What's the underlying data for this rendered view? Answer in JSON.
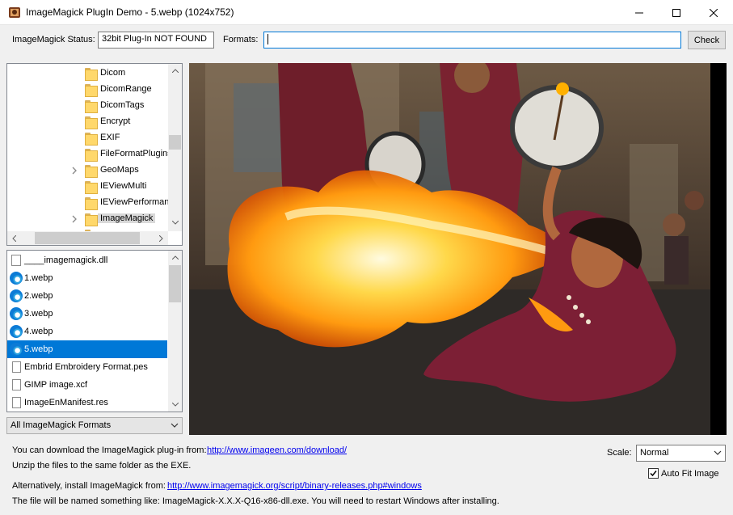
{
  "window": {
    "title": "ImageMagick PlugIn Demo - 5.webp (1024x752)",
    "controls": [
      "minimize-icon",
      "maximize-icon",
      "close-icon"
    ]
  },
  "status_bar": {
    "status_label": "ImageMagick Status:",
    "status_value": "32bit Plug-In NOT FOUND",
    "formats_label": "Formats:",
    "formats_value": "",
    "check_label": "Check"
  },
  "folder_tree": {
    "items": [
      {
        "label": "Dicom",
        "expandable": false
      },
      {
        "label": "DicomRange",
        "expandable": false
      },
      {
        "label": "DicomTags",
        "expandable": false
      },
      {
        "label": "Encrypt",
        "expandable": false
      },
      {
        "label": "EXIF",
        "expandable": false
      },
      {
        "label": "FileFormatPlugins",
        "expandable": false
      },
      {
        "label": "GeoMaps",
        "expandable": true
      },
      {
        "label": "IEViewMulti",
        "expandable": false
      },
      {
        "label": "IEViewPerformance",
        "expandable": false
      },
      {
        "label": "ImageMagick",
        "expandable": true,
        "selected": true
      }
    ]
  },
  "file_list": {
    "items": [
      {
        "label": "____imagemagick.dll",
        "icon": "dll-file-icon"
      },
      {
        "label": "1.webp",
        "icon": "edge-icon"
      },
      {
        "label": "2.webp",
        "icon": "edge-icon"
      },
      {
        "label": "3.webp",
        "icon": "edge-icon"
      },
      {
        "label": "4.webp",
        "icon": "edge-icon"
      },
      {
        "label": "5.webp",
        "icon": "edge-icon",
        "selected": true
      },
      {
        "label": "Embrid Embroidery Format.pes",
        "icon": "document-icon"
      },
      {
        "label": "GIMP image.xcf",
        "icon": "document-icon"
      },
      {
        "label": "ImageEnManifest.res",
        "icon": "document-icon"
      }
    ]
  },
  "filter": {
    "value": "All ImageMagick Formats"
  },
  "viewer": {
    "subject": "fire-breather performer with drummers",
    "accent": "#ffb000"
  },
  "info": {
    "download_text": "You can download the ImageMagick plug-in from:",
    "download_link": "http://www.imageen.com/download/",
    "unzip_text": "Unzip the files to the same folder as the EXE.",
    "alt_text": "Alternatively, install ImageMagick from:",
    "alt_link": "http://www.imagemagick.org/script/binary-releases.php#windows",
    "named_text": "The file will be named something like: ImageMagick-X.X.X-Q16-x86-dll.exe. You will need to restart Windows after installing."
  },
  "scale": {
    "label": "Scale:",
    "value": "Normal"
  },
  "auto_fit": {
    "label": "Auto Fit Image",
    "checked": true
  },
  "colors": {
    "selection": "#0078d7",
    "link": "#0000ee",
    "focus": "#0078d7"
  }
}
